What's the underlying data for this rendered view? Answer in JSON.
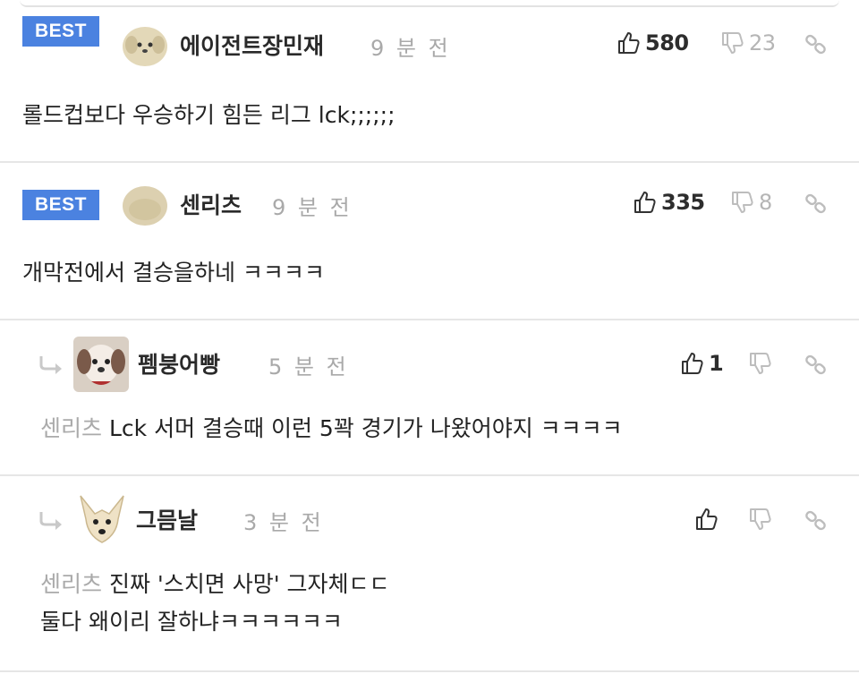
{
  "comments": [
    {
      "best_label": "BEST",
      "nickname": "에이전트장민재",
      "time": "9 분 전",
      "likes": "580",
      "dislikes": "23",
      "text": "롤드컵보다 우승하기 힘든 리그 lck;;;;;;"
    },
    {
      "best_label": "BEST",
      "nickname": "센리츠",
      "time": "9 분 전",
      "likes": "335",
      "dislikes": "8",
      "text": "개막전에서 결승을하네 ㅋㅋㅋㅋ"
    }
  ],
  "replies": [
    {
      "nickname": "펨붕어빵",
      "time": "5 분 전",
      "likes": "1",
      "mention": "센리츠",
      "text": "Lck 서머 결승때 이런 5꽉 경기가 나왔어야지 ㅋㅋㅋㅋ"
    },
    {
      "nickname": "그믐날",
      "time": "3 분 전",
      "mention": "센리츠",
      "text_line1": "진짜 '스치면 사망' 그자체ㄷㄷ",
      "text_line2": "둘다 왜이리 잘하냐ㅋㅋㅋㅋㅋㅋ"
    }
  ],
  "icons": {
    "like": "thumbs-up-icon",
    "dislike": "thumbs-down-icon",
    "link": "link-icon",
    "reply": "reply-arrow-icon"
  },
  "colors": {
    "best_badge": "#4b82e0",
    "muted": "#aaaaaa"
  }
}
